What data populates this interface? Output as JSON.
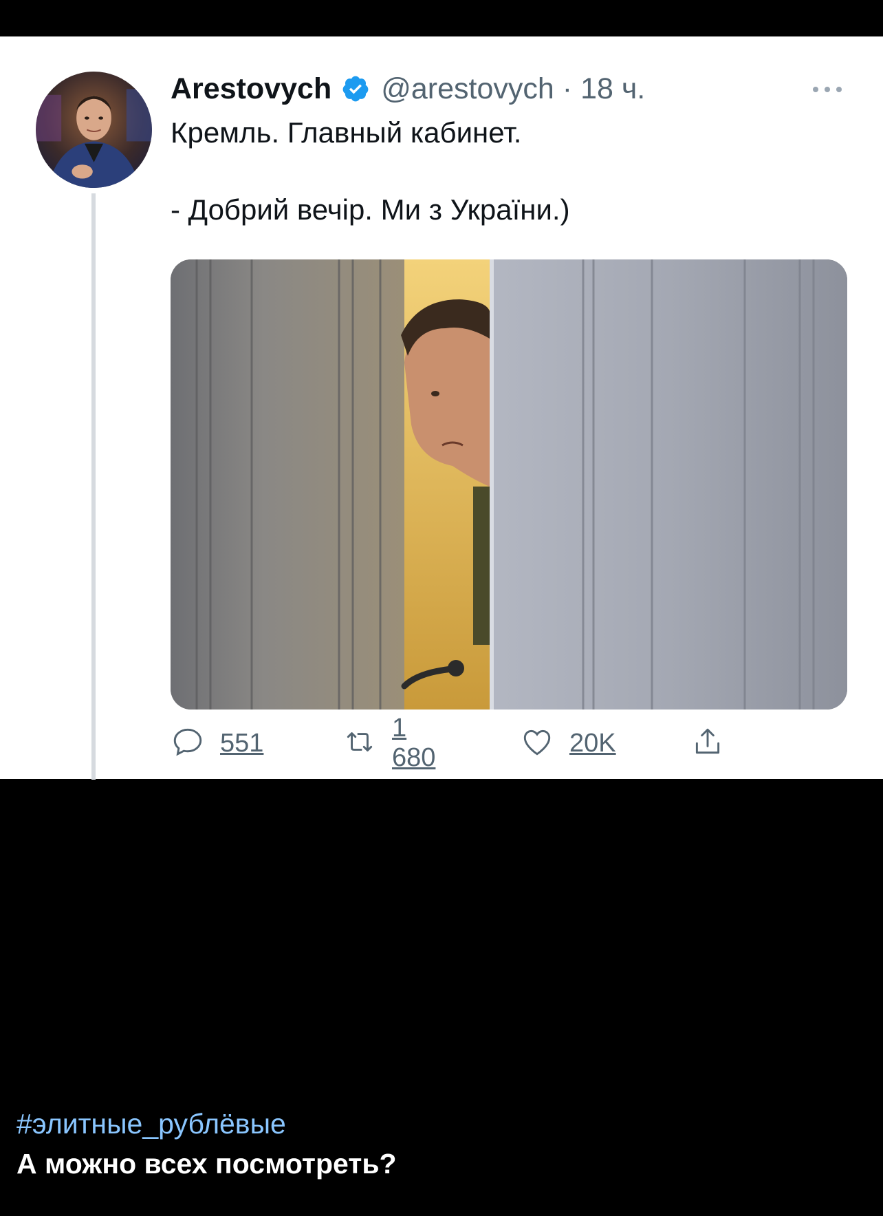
{
  "tweet": {
    "display_name": "Arestovych",
    "handle": "@arestovych",
    "separator": "·",
    "time": "18 ч.",
    "text_line_1": "Кремль. Главный кабинет.",
    "text_line_2": "- Добрий вечір. Ми з України.)",
    "stats": {
      "replies": "551",
      "retweets": "1 680",
      "likes": "20K"
    }
  },
  "caption": {
    "hashtag": "#элитные_рублёвые",
    "text": "А можно всех посмотреть?"
  },
  "colors": {
    "verified": "#1d9bf0",
    "hashtag": "#8ac6ff",
    "background": "#000000",
    "card": "#ffffff"
  },
  "icons": [
    "verified-badge-icon",
    "more-icon",
    "reply-icon",
    "retweet-icon",
    "like-icon",
    "share-icon"
  ]
}
